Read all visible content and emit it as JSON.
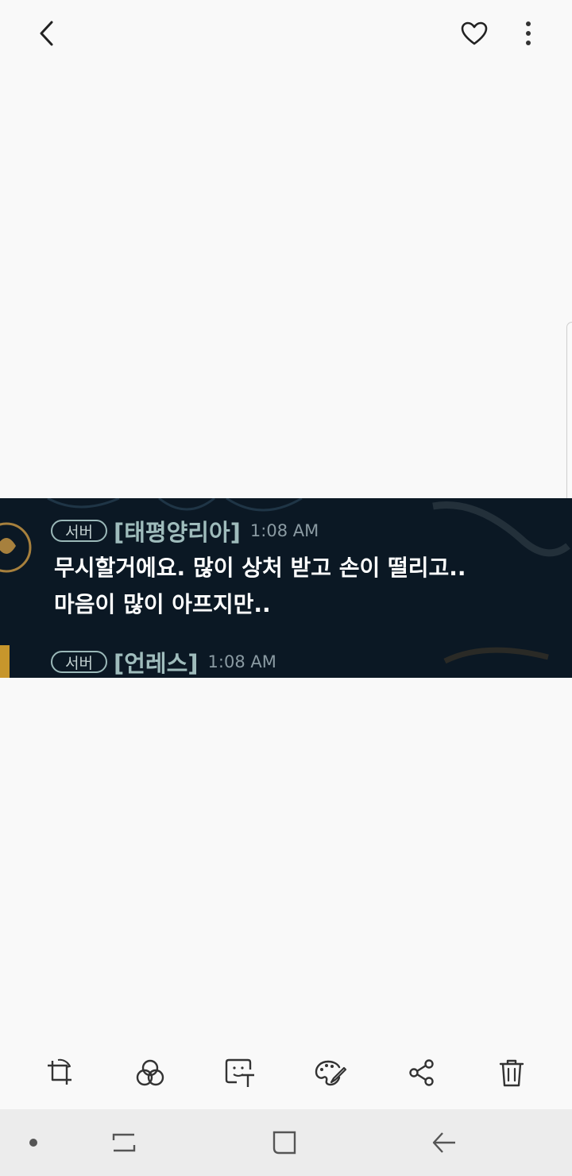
{
  "top_bar": {
    "back_icon": "chevron-left-icon",
    "favorite_icon": "heart-outline-icon",
    "more_icon": "more-vertical-icon"
  },
  "image": {
    "background_color": "#0b1824",
    "messages": [
      {
        "badge": "서버",
        "username": "[태평양리아]",
        "time": "1:08 AM",
        "lines": [
          "무시할거에요. 많이 상처 받고 손이 떨리고..",
          "마음이 많이 아프지만.."
        ]
      },
      {
        "badge": "서버",
        "username": "[언레스]",
        "time": "1:08 AM",
        "lines": []
      }
    ]
  },
  "toolbar": {
    "items": [
      {
        "icon": "crop-rotate-icon"
      },
      {
        "icon": "filter-circles-icon"
      },
      {
        "icon": "add-text-icon"
      },
      {
        "icon": "palette-draw-icon"
      },
      {
        "icon": "share-icon"
      },
      {
        "icon": "trash-icon"
      }
    ]
  },
  "nav_bar": {
    "background": "#ececec",
    "items": [
      "dot-icon",
      "recents-icon",
      "home-icon",
      "back-arrow-icon"
    ]
  }
}
